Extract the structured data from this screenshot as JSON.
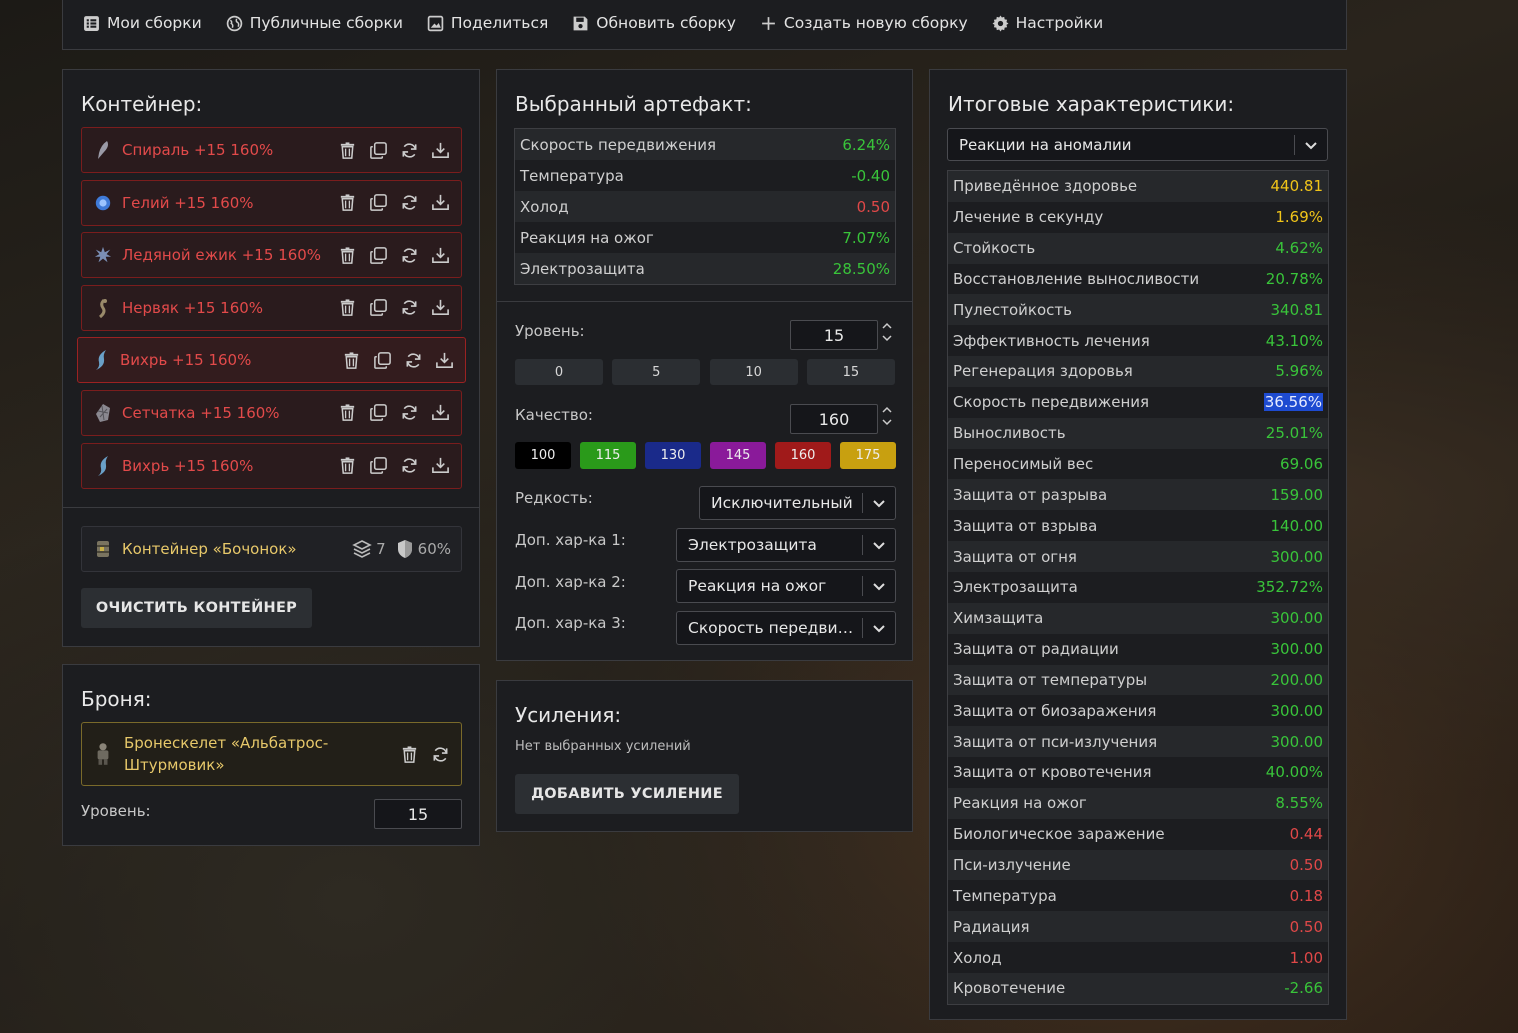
{
  "nav": [
    {
      "label": "Мои сборки",
      "icon": "list-icon"
    },
    {
      "label": "Публичные сборки",
      "icon": "globe-icon"
    },
    {
      "label": "Поделиться",
      "icon": "image-icon"
    },
    {
      "label": "Обновить сборку",
      "icon": "save-icon"
    },
    {
      "label": "Создать новую сборку",
      "icon": "plus-icon"
    },
    {
      "label": "Настройки",
      "icon": "gear-icon"
    }
  ],
  "container": {
    "title": "Контейнер:",
    "artifacts": [
      {
        "name": "Спираль +15 160%",
        "icon": "feather-icon",
        "color": "#9a9aa6"
      },
      {
        "name": "Гелий +15 160%",
        "icon": "orb-icon",
        "color": "#3f7ad8"
      },
      {
        "name": "Ледяной ежик +15 160%",
        "icon": "spiky-icon",
        "color": "#7b8fb5"
      },
      {
        "name": "Нервяк +15 160%",
        "icon": "root-icon",
        "color": "#9a8a6a"
      },
      {
        "name": "Вихрь +15 160%",
        "icon": "swirl-icon",
        "color": "#6aa0c8",
        "selected": true
      },
      {
        "name": "Сетчатка +15 160%",
        "icon": "mesh-icon",
        "color": "#8a8890"
      },
      {
        "name": "Вихрь +15 160%",
        "icon": "swirl-icon",
        "color": "#6aa0c8"
      }
    ],
    "box": {
      "name": "Контейнер «Бочонок»",
      "slots": "7",
      "protection": "60%"
    },
    "clear_label": "ОЧИСТИТЬ КОНТЕЙНЕР"
  },
  "armor": {
    "title": "Броня:",
    "name": "Бронескелет «Альбатрос-Штурмовик»",
    "level_label": "Уровень:",
    "level": "15"
  },
  "artifact": {
    "title": "Выбранный артефакт:",
    "stats": [
      {
        "label": "Скорость передвижения",
        "value": "6.24%",
        "tone": "green"
      },
      {
        "label": "Температура",
        "value": "-0.40",
        "tone": "green"
      },
      {
        "label": "Холод",
        "value": "0.50",
        "tone": "red"
      },
      {
        "label": "Реакция на ожог",
        "value": "7.07%",
        "tone": "green"
      },
      {
        "label": "Электрозащита",
        "value": "28.50%",
        "tone": "green"
      }
    ],
    "level_label": "Уровень:",
    "level": "15",
    "level_presets": [
      "0",
      "5",
      "10",
      "15"
    ],
    "quality_label": "Качество:",
    "quality": "160",
    "quality_presets": [
      {
        "label": "100",
        "color": "#000000"
      },
      {
        "label": "115",
        "color": "#2a9a1a"
      },
      {
        "label": "130",
        "color": "#1a2a8a"
      },
      {
        "label": "145",
        "color": "#8a1a9a"
      },
      {
        "label": "160",
        "color": "#a01a1a"
      },
      {
        "label": "175",
        "color": "#c8a010"
      }
    ],
    "rarity_label": "Редкость:",
    "rarity": "Исключительный",
    "extra1_label": "Доп. хар-ка 1:",
    "extra1": "Электрозащита",
    "extra2_label": "Доп. хар-ка 2:",
    "extra2": "Реакция на ожог",
    "extra3_label": "Доп. хар-ка 3:",
    "extra3": "Скорость передвижения"
  },
  "boosts": {
    "title": "Усиления:",
    "empty": "Нет выбранных усилений",
    "add_label": "ДОБАВИТЬ УСИЛЕНИЕ"
  },
  "total": {
    "title": "Итоговые характеристики:",
    "filter": "Реакции на аномалии",
    "stats": [
      {
        "label": "Приведённое здоровье",
        "value": "440.81",
        "tone": "yellow"
      },
      {
        "label": "Лечение в секунду",
        "value": "1.69%",
        "tone": "yellow"
      },
      {
        "label": "Стойкость",
        "value": "4.62%",
        "tone": "green"
      },
      {
        "label": "Восстановление выносливости",
        "value": "20.78%",
        "tone": "green"
      },
      {
        "label": "Пулестойкость",
        "value": "340.81",
        "tone": "green"
      },
      {
        "label": "Эффективность лечения",
        "value": "43.10%",
        "tone": "green"
      },
      {
        "label": "Регенерация здоровья",
        "value": "5.96%",
        "tone": "green"
      },
      {
        "label": "Скорость передвижения",
        "value": "36.56%",
        "tone": "sel"
      },
      {
        "label": "Выносливость",
        "value": "25.01%",
        "tone": "green"
      },
      {
        "label": "Переносимый вес",
        "value": "69.06",
        "tone": "green"
      },
      {
        "label": "Защита от разрыва",
        "value": "159.00",
        "tone": "green"
      },
      {
        "label": "Защита от взрыва",
        "value": "140.00",
        "tone": "green"
      },
      {
        "label": "Защита от огня",
        "value": "300.00",
        "tone": "green"
      },
      {
        "label": "Электрозащита",
        "value": "352.72%",
        "tone": "green"
      },
      {
        "label": "Химзащита",
        "value": "300.00",
        "tone": "green"
      },
      {
        "label": "Защита от радиации",
        "value": "300.00",
        "tone": "green"
      },
      {
        "label": "Защита от температуры",
        "value": "200.00",
        "tone": "green"
      },
      {
        "label": "Защита от биозаражения",
        "value": "300.00",
        "tone": "green"
      },
      {
        "label": "Защита от пси-излучения",
        "value": "300.00",
        "tone": "green"
      },
      {
        "label": "Защита от кровотечения",
        "value": "40.00%",
        "tone": "green"
      },
      {
        "label": "Реакция на ожог",
        "value": "8.55%",
        "tone": "green"
      },
      {
        "label": "Биологическое заражение",
        "value": "0.44",
        "tone": "red"
      },
      {
        "label": "Пси-излучение",
        "value": "0.50",
        "tone": "red"
      },
      {
        "label": "Температура",
        "value": "0.18",
        "tone": "red"
      },
      {
        "label": "Радиация",
        "value": "0.50",
        "tone": "red"
      },
      {
        "label": "Холод",
        "value": "1.00",
        "tone": "red"
      },
      {
        "label": "Кровотечение",
        "value": "-2.66",
        "tone": "green"
      }
    ]
  }
}
